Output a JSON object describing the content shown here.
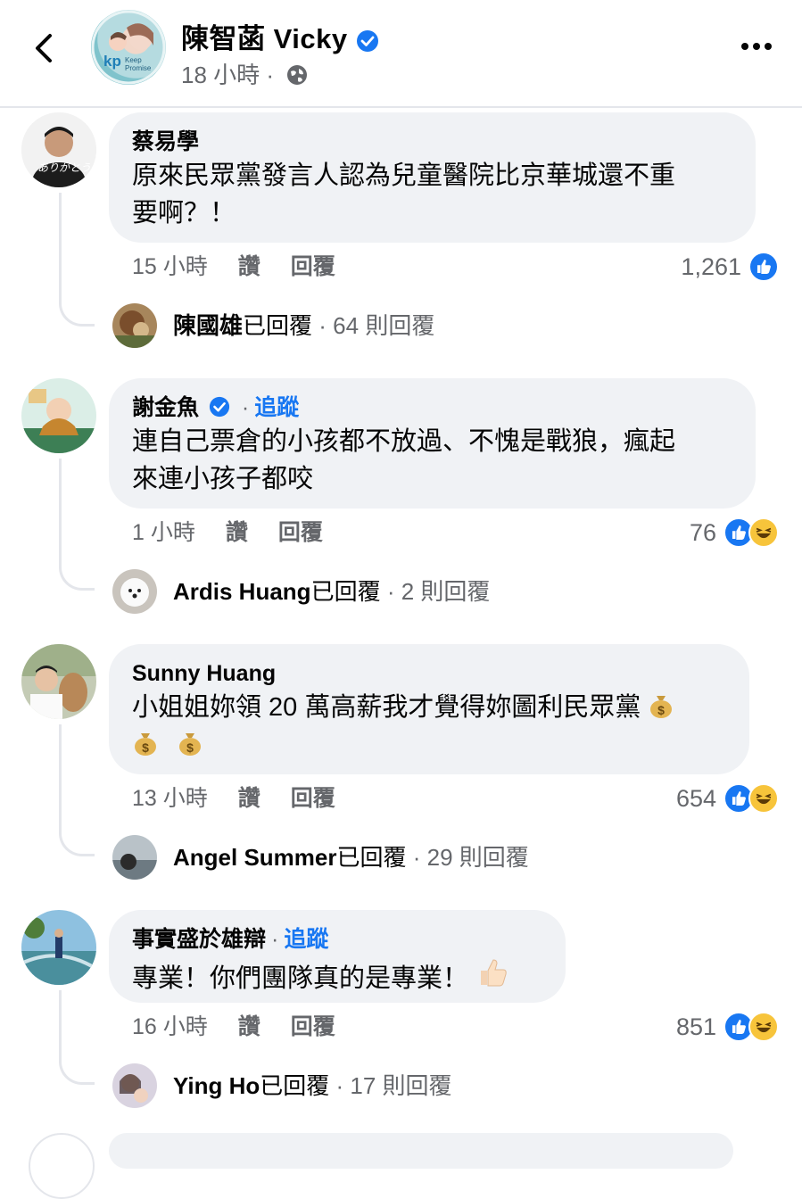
{
  "header": {
    "name": "陳智菡 Vicky",
    "time": "18 小時",
    "dot": "·",
    "avatar_logo": "Keep Promise",
    "avatar_logo_short": "kp"
  },
  "labels": {
    "like": "讚",
    "reply": "回覆",
    "replied": "已回覆",
    "dot": "·"
  },
  "comments": [
    {
      "author": "蔡易學",
      "text_line1": "原來民眾黨發言人認為兒童醫院比京華城還不重",
      "text_line2": "要啊？！",
      "time": "15 小時",
      "reaction_count": "1,261",
      "reactions": [
        "like"
      ],
      "reply_author": "陳國雄",
      "reply_count": "64 則回覆"
    },
    {
      "author": "謝金魚",
      "verified": true,
      "follow": "追蹤",
      "text_line1": "連自己票倉的小孩都不放過、不愧是戰狼，瘋起",
      "text_line2": "來連小孩子都咬",
      "time": "1 小時",
      "reaction_count": "76",
      "reactions": [
        "like",
        "haha"
      ],
      "reply_author": "Ardis Huang",
      "reply_count": "2 則回覆"
    },
    {
      "author": "Sunny Huang",
      "text_line1": "小姐姐妳領 20 萬高薪我才覺得妳圖利民眾黨",
      "text_line2": "",
      "time": "13 小時",
      "reaction_count": "654",
      "reactions": [
        "like",
        "haha"
      ],
      "reply_author": "Angel Summer",
      "reply_count": "29 則回覆"
    },
    {
      "author": "事實盛於雄辯",
      "follow": "追蹤",
      "text_line1": "專業！你們團隊真的是專業！",
      "text_line2": "",
      "time": "16 小時",
      "reaction_count": "851",
      "reactions": [
        "like",
        "haha"
      ],
      "reply_author": "Ying Ho",
      "reply_count": "17 則回覆"
    }
  ],
  "colors": {
    "accent": "#1877f2",
    "bubble": "#f0f2f5",
    "secondary_text": "#65676b",
    "haha": "#f7c43b"
  },
  "icons": [
    "back-icon",
    "verified-icon",
    "globe-icon",
    "more-icon",
    "like-reaction-icon",
    "haha-reaction-icon",
    "money-bag-icon",
    "thumbs-up-icon"
  ]
}
